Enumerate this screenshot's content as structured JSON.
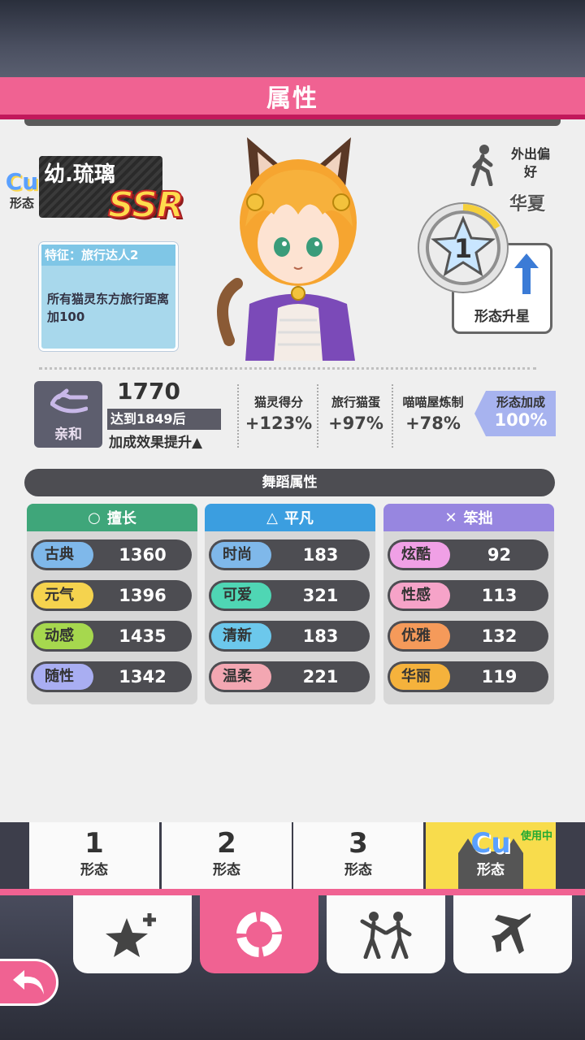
{
  "title": "属性",
  "character": {
    "type_badge": "Cu",
    "type_label": "形态",
    "name": "幼.琉璃",
    "rarity": "SSR"
  },
  "feature": {
    "title": "特征：旅行达人2",
    "description": "所有猫灵东方旅行距离加100"
  },
  "outing": {
    "label": "外出偏好",
    "value": "华夏"
  },
  "star": {
    "level": "1",
    "button_label": "形态升星"
  },
  "affinity": {
    "label": "亲和",
    "value": "1770",
    "reach_text": "达到1849后",
    "boost_text": "加成效果提升▲"
  },
  "stats": [
    {
      "label": "猫灵得分",
      "value": "+123%"
    },
    {
      "label": "旅行猫蛋",
      "value": "+97%"
    },
    {
      "label": "喵喵屋炼制",
      "value": "+78%"
    }
  ],
  "form_bonus": {
    "label": "形态加成",
    "value": "100%"
  },
  "dance": {
    "header": "舞蹈属性",
    "columns": [
      {
        "title": "擅长",
        "symbol": "○",
        "color": "#3fa67a",
        "rows": [
          {
            "name": "古典",
            "value": "1360",
            "color": "#7fb8ea"
          },
          {
            "name": "元气",
            "value": "1396",
            "color": "#f5d34e"
          },
          {
            "name": "动感",
            "value": "1435",
            "color": "#a6d84e"
          },
          {
            "name": "随性",
            "value": "1342",
            "color": "#a9aef2"
          }
        ]
      },
      {
        "title": "平凡",
        "symbol": "△",
        "color": "#3b9ee0",
        "rows": [
          {
            "name": "时尚",
            "value": "183",
            "color": "#7fb8ea"
          },
          {
            "name": "可爱",
            "value": "321",
            "color": "#4fd6b4"
          },
          {
            "name": "清新",
            "value": "183",
            "color": "#6cc8ec"
          },
          {
            "name": "温柔",
            "value": "221",
            "color": "#f3a7b2"
          }
        ]
      },
      {
        "title": "笨拙",
        "symbol": "✕",
        "color": "#9786e0",
        "rows": [
          {
            "name": "炫酷",
            "value": "92",
            "color": "#f0a0e6"
          },
          {
            "name": "性感",
            "value": "113",
            "color": "#f6a3c8"
          },
          {
            "name": "优雅",
            "value": "132",
            "color": "#f59a5a"
          },
          {
            "name": "华丽",
            "value": "119",
            "color": "#f5b23c"
          }
        ]
      }
    ]
  },
  "form_tabs": [
    {
      "num": "1",
      "label": "形态"
    },
    {
      "num": "2",
      "label": "形态"
    },
    {
      "num": "3",
      "label": "形态"
    },
    {
      "num": "Cu",
      "label": "形态",
      "badge": "使用中"
    }
  ],
  "nav": [
    {
      "icon": "star-plus-icon"
    },
    {
      "icon": "donut-chart-icon"
    },
    {
      "icon": "dance-icon"
    },
    {
      "icon": "airplane-icon"
    }
  ],
  "colors": {
    "accent": "#f06292",
    "active_tab": "#f8dc4c"
  }
}
